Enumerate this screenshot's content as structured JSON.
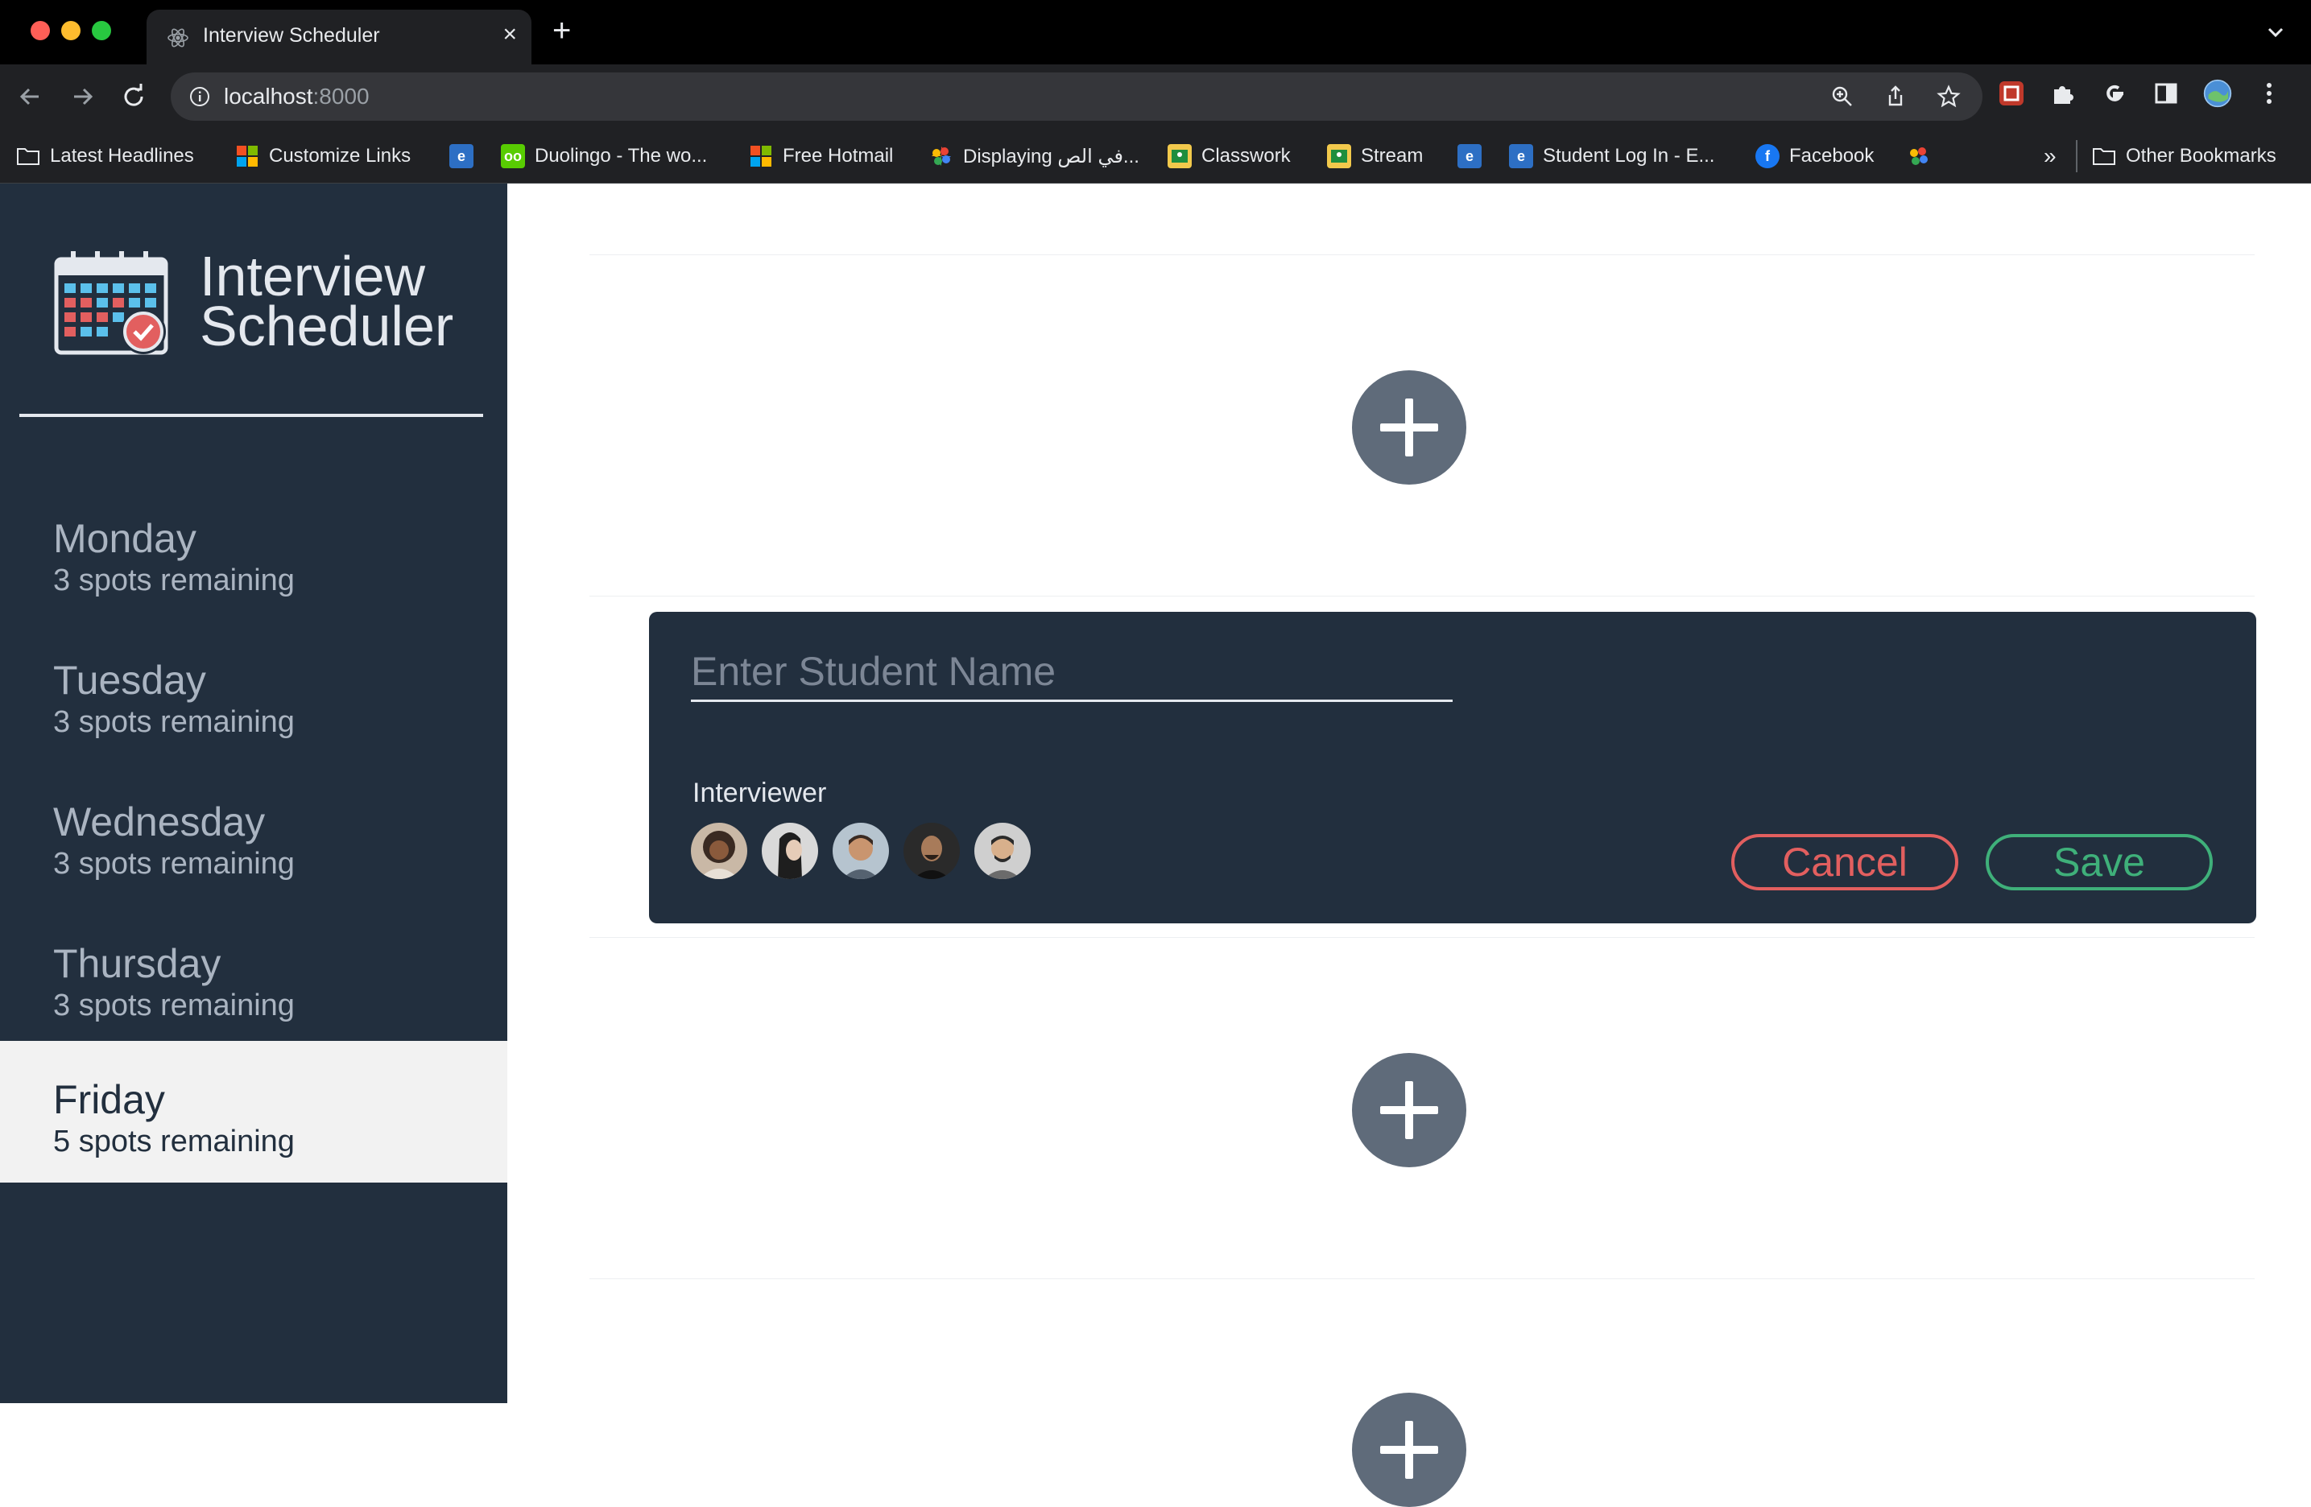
{
  "browser": {
    "tab_title": "Interview Scheduler",
    "url_host": "localhost",
    "url_port": ":8000",
    "bookmarks": [
      {
        "label": "Latest Headlines",
        "icon": "folder-icon"
      },
      {
        "label": "Customize Links",
        "icon": "microsoft-icon"
      },
      {
        "label": "",
        "icon": "app-icon"
      },
      {
        "label": "Duolingo - The wo...",
        "icon": "duolingo-icon"
      },
      {
        "label": "Free Hotmail",
        "icon": "microsoft-icon"
      },
      {
        "label": "Displaying في الص...",
        "icon": "pinwheel-icon"
      },
      {
        "label": "Classwork",
        "icon": "classroom-icon"
      },
      {
        "label": "Stream",
        "icon": "classroom-icon"
      },
      {
        "label": "",
        "icon": "app-icon"
      },
      {
        "label": "Student Log In - E...",
        "icon": "app-icon"
      },
      {
        "label": "Facebook",
        "icon": "facebook-icon"
      },
      {
        "label": "",
        "icon": "pinwheel-icon"
      }
    ],
    "overflow_label": "»",
    "other_bookmarks": "Other Bookmarks"
  },
  "app": {
    "brand_line1": "Interview",
    "brand_line2": "Scheduler",
    "days": [
      {
        "name": "Monday",
        "spots": "3 spots remaining",
        "selected": false
      },
      {
        "name": "Tuesday",
        "spots": "3 spots remaining",
        "selected": false
      },
      {
        "name": "Wednesday",
        "spots": "3 spots remaining",
        "selected": false
      },
      {
        "name": "Thursday",
        "spots": "3 spots remaining",
        "selected": false
      },
      {
        "name": "Friday",
        "spots": "5 spots remaining",
        "selected": true
      }
    ],
    "form": {
      "name_placeholder": "Enter Student Name",
      "name_value": "",
      "interviewer_label": "Interviewer",
      "cancel_label": "Cancel",
      "save_label": "Save"
    }
  },
  "colors": {
    "sidebar_bg": "#222f3e",
    "selected_day_bg": "#f2f2f2",
    "add_button": "#5f6b7a",
    "cancel": "#e25f5f",
    "save": "#3fb07a"
  }
}
